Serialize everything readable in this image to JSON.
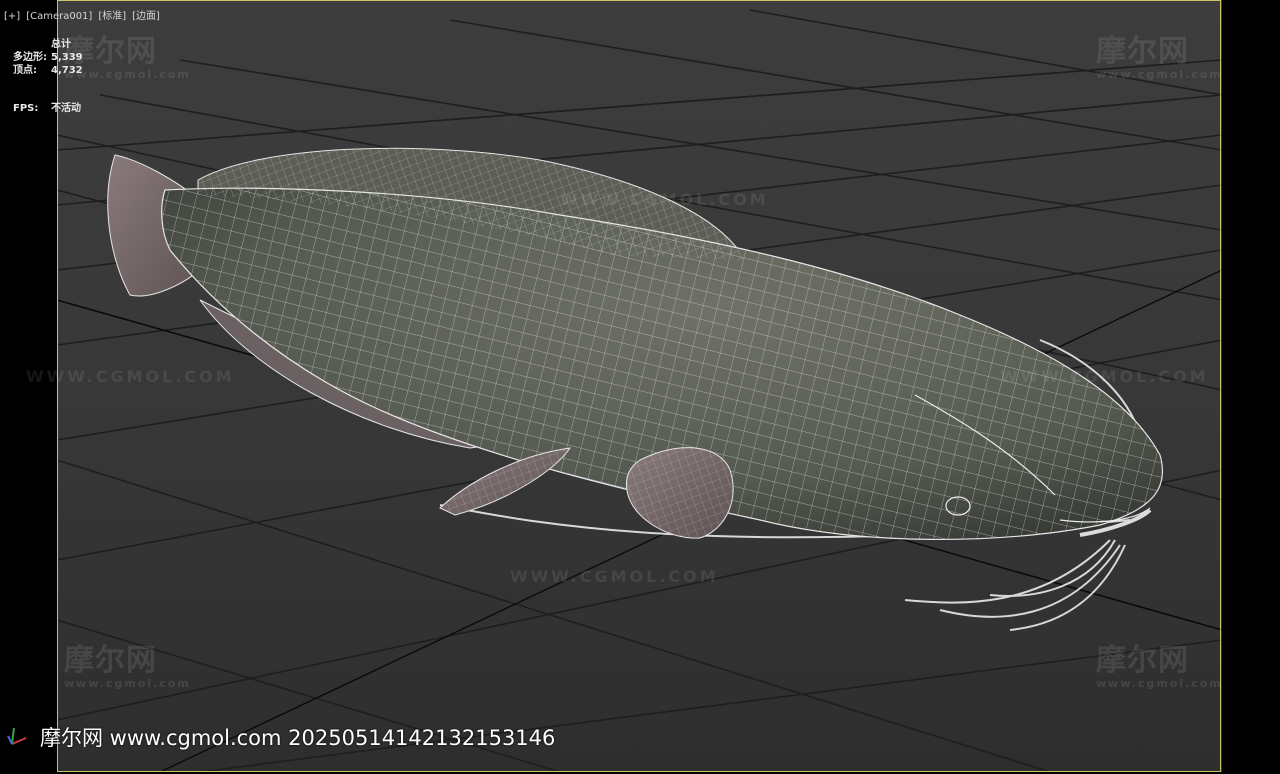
{
  "viewport": {
    "labels": [
      "[+]",
      "[Camera001]",
      "[标准]",
      "[边面]"
    ]
  },
  "stats": {
    "header": "总计",
    "polygons_label": "多边形:",
    "polygons_value": "5,339",
    "vertices_label": "顶点:",
    "vertices_value": "4,732",
    "fps_label": "FPS:",
    "fps_value": "不活动"
  },
  "watermarks": {
    "logo": "摩尔网",
    "logo_sub": "www.cgmol.com",
    "url": "WWW.CGMOL.COM"
  },
  "footer": {
    "text": "摩尔网 www.cgmol.com 20250514142132153146"
  },
  "colors": {
    "frame": "#c9c36a",
    "viewport_bg": "#3a3a3a",
    "grid": "#1c1c1c",
    "wire": "#e6e6e6"
  }
}
